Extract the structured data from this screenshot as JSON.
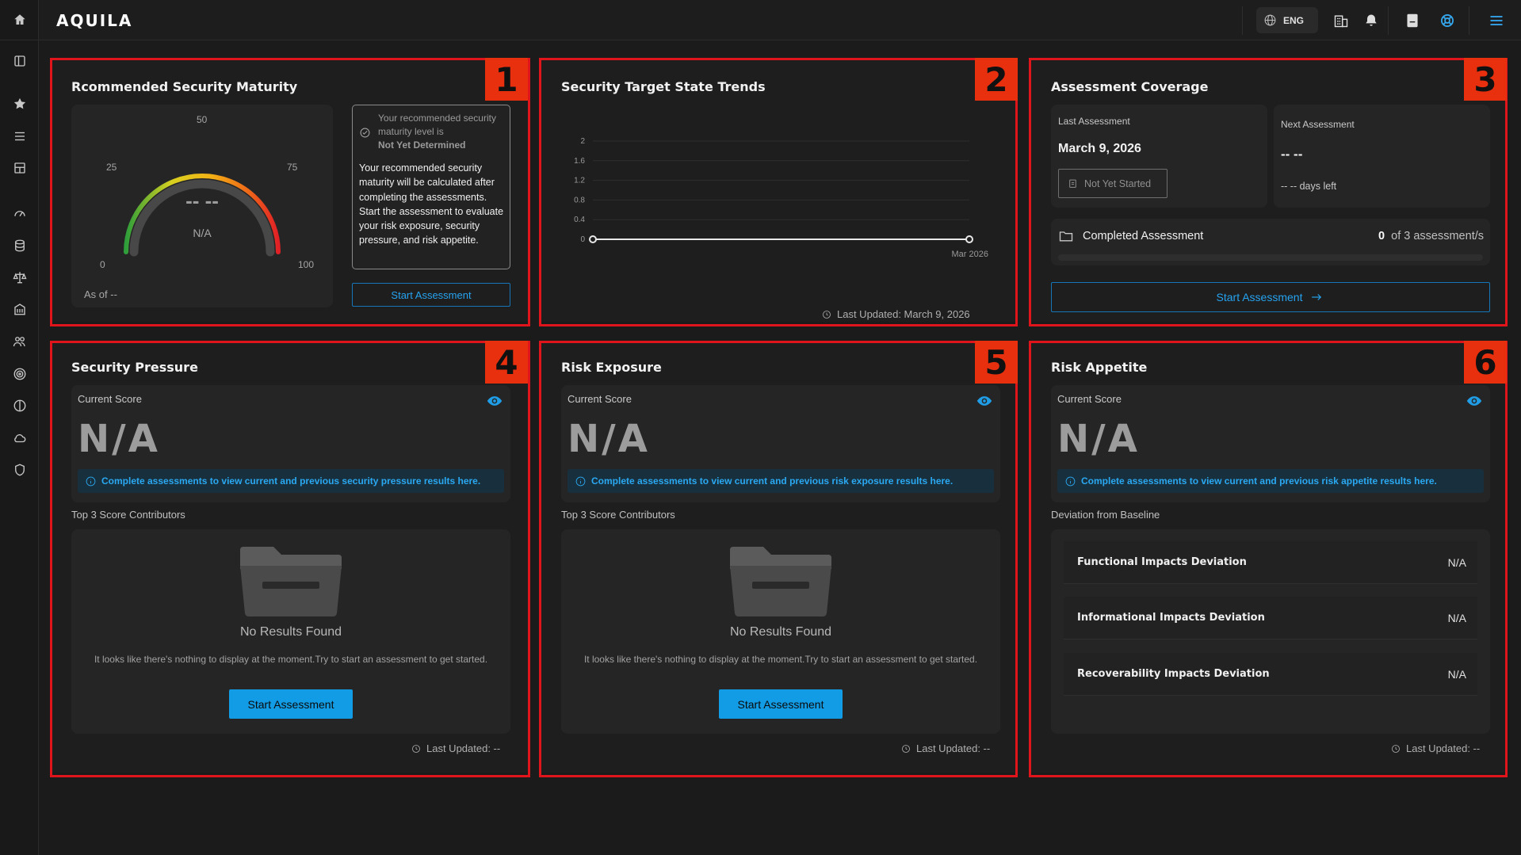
{
  "app": {
    "logo": "AQUILA"
  },
  "topbar": {
    "language": "ENG"
  },
  "panels": {
    "p1": {
      "badge": "1",
      "title": "Rcommended Security Maturity",
      "gauge": {
        "ticks": {
          "t0": "0",
          "t25": "25",
          "t50": "50",
          "t75": "75",
          "t100": "100"
        },
        "value": "-- --",
        "value_label": "N/A"
      },
      "as_of": "As of --",
      "notice_line1": "Your recommended security maturity level is",
      "notice_status": "Not Yet Determined",
      "notice_body": "Your recommended security maturity will be calculated after completing the assessments. Start the assessment to evaluate your risk exposure, security pressure, and risk appetite.",
      "button": "Start Assessment"
    },
    "p2": {
      "badge": "2",
      "title": "Security Target State Trends",
      "last_updated": "Last Updated: March 9, 2026"
    },
    "p3": {
      "badge": "3",
      "title": "Assessment Coverage",
      "last_label": "Last Assessment",
      "last_date": "March 9, 2026",
      "status": "Not Yet Started",
      "next_label": "Next Assessment",
      "next_date": "-- --",
      "days_left": "-- -- days left",
      "completed_label": "Completed Assessment",
      "completed_count": "0",
      "completed_total": "of 3 assessment/s",
      "completed_fraction": 0,
      "button": "Start Assessment"
    },
    "p4": {
      "badge": "4",
      "title": "Security Pressure",
      "score_label": "Current Score",
      "score": "N/A",
      "info": "Complete assessments to view current and previous security pressure results here.",
      "section": "Top 3 Score Contributors",
      "empty_title": "No Results Found",
      "empty_text": "It looks like there's nothing to display at the moment.Try to start an assessment to get started.",
      "button": "Start Assessment",
      "last_updated": "Last Updated: --"
    },
    "p5": {
      "badge": "5",
      "title": "Risk Exposure",
      "score_label": "Current Score",
      "score": "N/A",
      "info": "Complete assessments to view current and previous risk exposure results here.",
      "section": "Top 3 Score Contributors",
      "empty_title": "No Results Found",
      "empty_text": "It looks like there's nothing to display at the moment.Try to start an assessment to get started.",
      "button": "Start Assessment",
      "last_updated": "Last Updated: --"
    },
    "p6": {
      "badge": "6",
      "title": "Risk Appetite",
      "score_label": "Current Score",
      "score": "N/A",
      "info": "Complete assessments to view current and previous risk appetite results here.",
      "section": "Deviation from Baseline",
      "rows": [
        {
          "label": "Functional Impacts Deviation",
          "value": "N/A"
        },
        {
          "label": "Informational Impacts Deviation",
          "value": "N/A"
        },
        {
          "label": "Recoverability Impacts Deviation",
          "value": "N/A"
        }
      ],
      "last_updated": "Last Updated: --"
    }
  },
  "chart_data": {
    "type": "line",
    "x": [
      "Mar 2026"
    ],
    "y_ticks": [
      "0",
      "0.4",
      "0.8",
      "1.2",
      "1.6",
      "2"
    ],
    "ylim": [
      0,
      2
    ],
    "series": [
      {
        "values": [
          0,
          0
        ]
      }
    ],
    "x_tick_label": "Mar 2026",
    "grid": true
  },
  "colors": {
    "accent": "#129ce5",
    "highlight_border": "#e0141b",
    "badge": "#e8300f"
  }
}
